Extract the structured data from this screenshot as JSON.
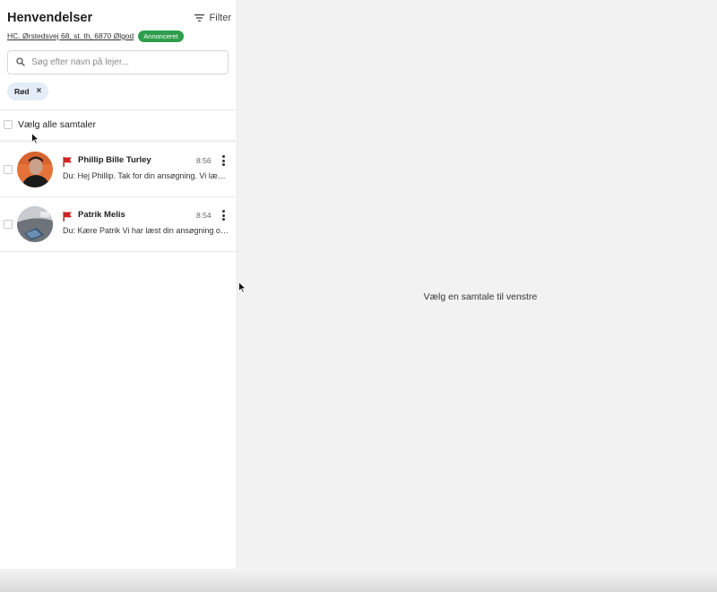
{
  "header": {
    "title": "Henvendelser",
    "filter_label": "Filter"
  },
  "property": {
    "address": "HC. Ørstedsvej 68, st. th, 6870 Ølgod",
    "status_badge": "Annonceret"
  },
  "search": {
    "placeholder": "Søg efter navn på lejer...",
    "value": ""
  },
  "active_filters": [
    {
      "label": "Rød"
    }
  ],
  "select_all": {
    "label": "Vælg alle samtaler"
  },
  "conversations": [
    {
      "name": "Phillip Bille Turley",
      "time": "8:56",
      "preview": "Du: Hej Phillip. Tak for din ansøgning. Vi læser den og vender tilbage",
      "flag": "red-flag-icon"
    },
    {
      "name": "Patrik Melis",
      "time": "8:54",
      "preview": "Du: Kære Patrik Vi har læst din ansøgning og vender tilbage",
      "flag": "red-flag-icon"
    }
  ],
  "main": {
    "empty_state": "Vælg en samtale til venstre"
  },
  "colors": {
    "badge_green": "#2e9e4c",
    "flag_red": "#d42020",
    "chip_bg": "#e4ecf7",
    "panel_bg": "#f2f2f2"
  }
}
